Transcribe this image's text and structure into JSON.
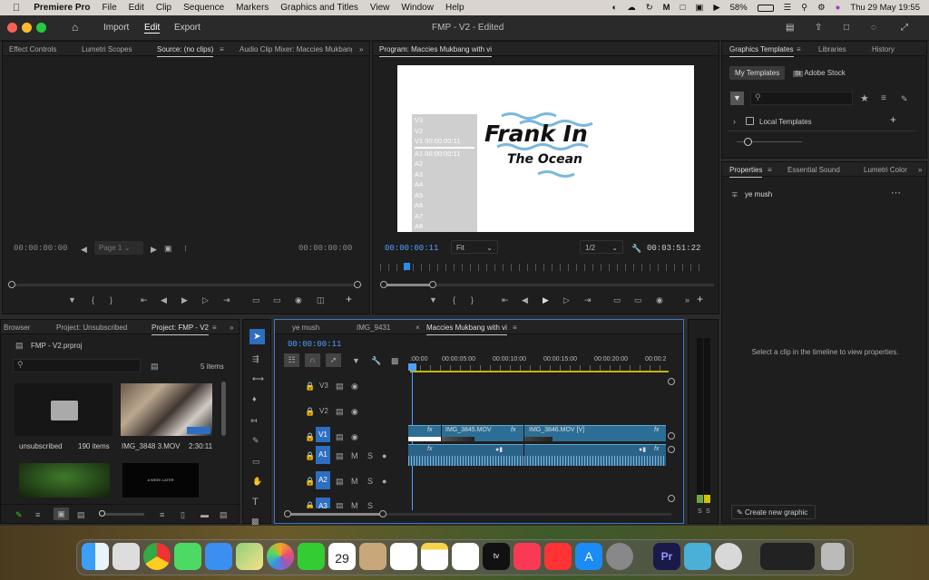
{
  "menubar": {
    "app": "Premiere Pro",
    "items": [
      "File",
      "Edit",
      "Clip",
      "Sequence",
      "Markers",
      "Graphics and Titles",
      "View",
      "Window",
      "Help"
    ],
    "battery": "58%",
    "clock": "Thu 29 May  19:55"
  },
  "window": {
    "title": "FMP - V2 - Edited",
    "nav": [
      "Import",
      "Edit",
      "Export"
    ]
  },
  "source_panel": {
    "tabs": [
      "Effect Controls",
      "Lumetri Scopes",
      "Source: (no clips)",
      "Audio Clip Mixer: Maccies Mukbang w"
    ],
    "tc_left": "00:00:00:00",
    "tc_right": "00:00:00:00",
    "page": "Page 1"
  },
  "program_panel": {
    "tab": "Program: Maccies Mukbang with vi",
    "tc_current": "00:00:00:11",
    "fit": "Fit",
    "res": "1/2",
    "tc_duration": "00:03:51:22",
    "overlay_tracks": [
      "V3",
      "V2",
      "V1 00:00:00:11",
      "A1 00:00:00:11",
      "A2",
      "A3",
      "A4",
      "A5",
      "A6",
      "A7",
      "A8"
    ],
    "title_line1": "Frank In",
    "title_line2": "The Ocean"
  },
  "graphics_panel": {
    "tabs": [
      "Graphics Templates",
      "Libraries",
      "History"
    ],
    "subtabs": [
      "My Templates",
      "Adobe Stock"
    ],
    "local_templates": "Local Templates"
  },
  "properties_panel": {
    "tabs": [
      "Properties",
      "Essential Sound",
      "Lumetri Color"
    ],
    "clip_name": "ye mush",
    "message": "Select a clip in the timeline to view properties.",
    "create_button": "Create new graphic"
  },
  "project_panel": {
    "tabs": [
      "Browser",
      "Project: Unsubscribed",
      "Project: FMP - V2"
    ],
    "file": "FMP - V2.prproj",
    "count": "5 items",
    "items": [
      {
        "name": "unsubscribed",
        "meta": "190 items"
      },
      {
        "name": "IMG_3848 3.MOV",
        "meta": "2:30:11"
      }
    ],
    "thumb_text": "A WEEK LATER"
  },
  "timeline": {
    "tabs": [
      "ye mush",
      "IMG_9431",
      "Maccies Mukbang with vi"
    ],
    "tc": "00:00:00:11",
    "ruler": [
      ":00:00",
      "00:00:05:00",
      "00:00:10:00",
      "00:00:15:00",
      "00:00:20:00",
      "00:00:2"
    ],
    "video_tracks": [
      "V3",
      "V2",
      "V1"
    ],
    "audio_tracks": [
      "A1",
      "A2",
      "A3"
    ],
    "clips": [
      "IMG_3845.MOV",
      "IMG_3846.MOV [V]"
    ],
    "fx": "fx"
  },
  "colors": {
    "accent": "#2d8ceb",
    "clip": "#2c6e95",
    "panel": "#1e1e1e"
  }
}
